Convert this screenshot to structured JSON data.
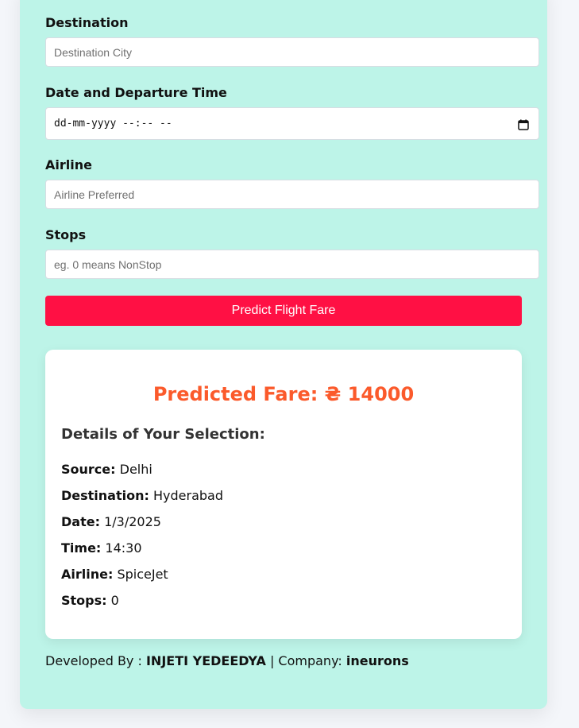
{
  "form": {
    "destination_label": "Destination",
    "destination_placeholder": "Destination City",
    "datetime_label": "Date and Departure Time",
    "datetime_value": "dd-mm-yyyy --:-- --",
    "airline_label": "Airline",
    "airline_placeholder": "Airline Preferred",
    "stops_label": "Stops",
    "stops_placeholder": "eg. 0 means NonStop",
    "submit_label": "Predict Flight Fare"
  },
  "result": {
    "prediction": "Predicted Fare: ₴ 14000",
    "details_heading": "Details of Your Selection:",
    "details": [
      {
        "label": "Source:",
        "value": "Delhi"
      },
      {
        "label": "Destination:",
        "value": "Hyderabad"
      },
      {
        "label": "Date:",
        "value": "1/3/2025"
      },
      {
        "label": "Time:",
        "value": "14:30"
      },
      {
        "label": "Airline:",
        "value": "SpiceJet"
      },
      {
        "label": "Stops:",
        "value": "0"
      }
    ]
  },
  "footer": {
    "developed_prefix": "Developed By :",
    "developer": "INJETI YEDEEDYA",
    "company_prefix": "| Company:",
    "company": "ineurons"
  },
  "icons": {
    "datetime_picker": "calendar-icon"
  },
  "colors": {
    "card_background": "#bdf4e8",
    "button": "#ff1044",
    "prediction_text": "#fb5a2b"
  }
}
